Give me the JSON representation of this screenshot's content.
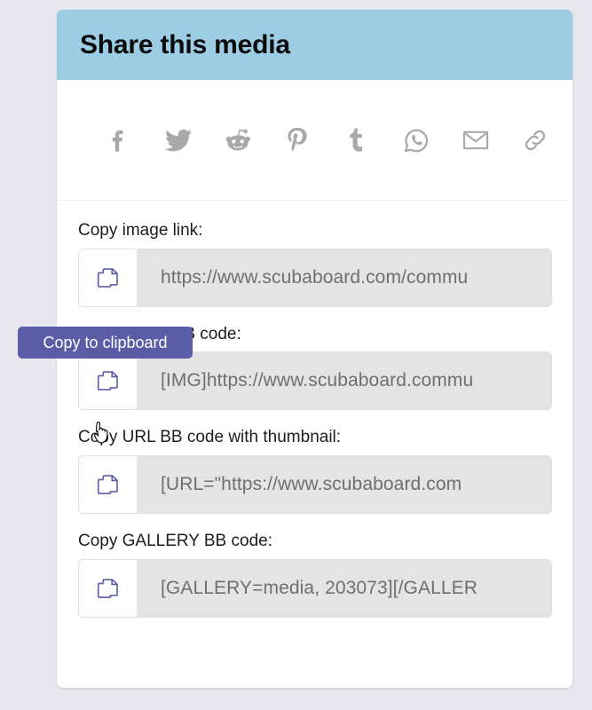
{
  "dialog": {
    "title": "Share this media"
  },
  "social": {
    "items": [
      {
        "name": "facebook-icon",
        "label": "Facebook"
      },
      {
        "name": "twitter-icon",
        "label": "Twitter"
      },
      {
        "name": "reddit-icon",
        "label": "Reddit"
      },
      {
        "name": "pinterest-icon",
        "label": "Pinterest"
      },
      {
        "name": "tumblr-icon",
        "label": "Tumblr"
      },
      {
        "name": "whatsapp-icon",
        "label": "WhatsApp"
      },
      {
        "name": "email-icon",
        "label": "Email"
      },
      {
        "name": "link-icon",
        "label": "Link"
      }
    ]
  },
  "fields": [
    {
      "label": "Copy image link:",
      "value": "https://www.scubaboard.com/commu",
      "icon": "copy-icon"
    },
    {
      "label": "Copy image BB code:",
      "value": "[IMG]https://www.scubaboard.commu",
      "icon": "copy-icon"
    },
    {
      "label": "Copy URL BB code with thumbnail:",
      "value": "[URL=\"https://www.scubaboard.com",
      "icon": "copy-icon"
    },
    {
      "label": "Copy GALLERY BB code:",
      "value": "[GALLERY=media, 203073][/GALLER",
      "icon": "copy-icon"
    }
  ],
  "tooltip": {
    "text": "Copy to clipboard"
  },
  "colors": {
    "page_background": "#e8e7f0",
    "header_background": "#9ccde5",
    "tooltip_background": "#5b5ea6",
    "copy_icon": "#5b5ea6",
    "field_background": "#e4e4e4",
    "social_icon": "#a9a9a9"
  }
}
